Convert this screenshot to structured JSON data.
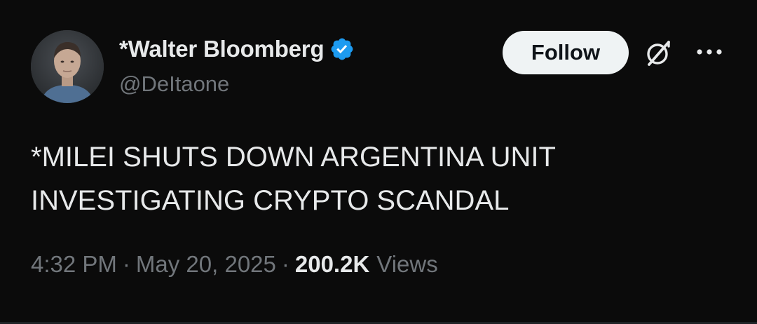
{
  "author": {
    "display_name": "*Walter Bloomberg",
    "handle": "@DeItaone",
    "verified": true,
    "verified_color": "#1d9bf0",
    "avatar_icon": "profile-photo"
  },
  "actions": {
    "follow_label": "Follow",
    "grok_icon": "grok-icon",
    "more_icon": "more-icon"
  },
  "tweet": {
    "lines": [
      "*MILEI SHUTS DOWN ARGENTINA UNIT",
      "INVESTIGATING CRYPTO SCANDAL"
    ]
  },
  "meta": {
    "time": "4:32 PM",
    "separator": "·",
    "date": "May 20, 2025",
    "views_count": "200.2K",
    "views_label": "Views"
  },
  "colors": {
    "background": "#0b0b0b",
    "primary_text": "#e7e9ea",
    "secondary_text": "#71767b",
    "follow_bg": "#eff3f4"
  }
}
